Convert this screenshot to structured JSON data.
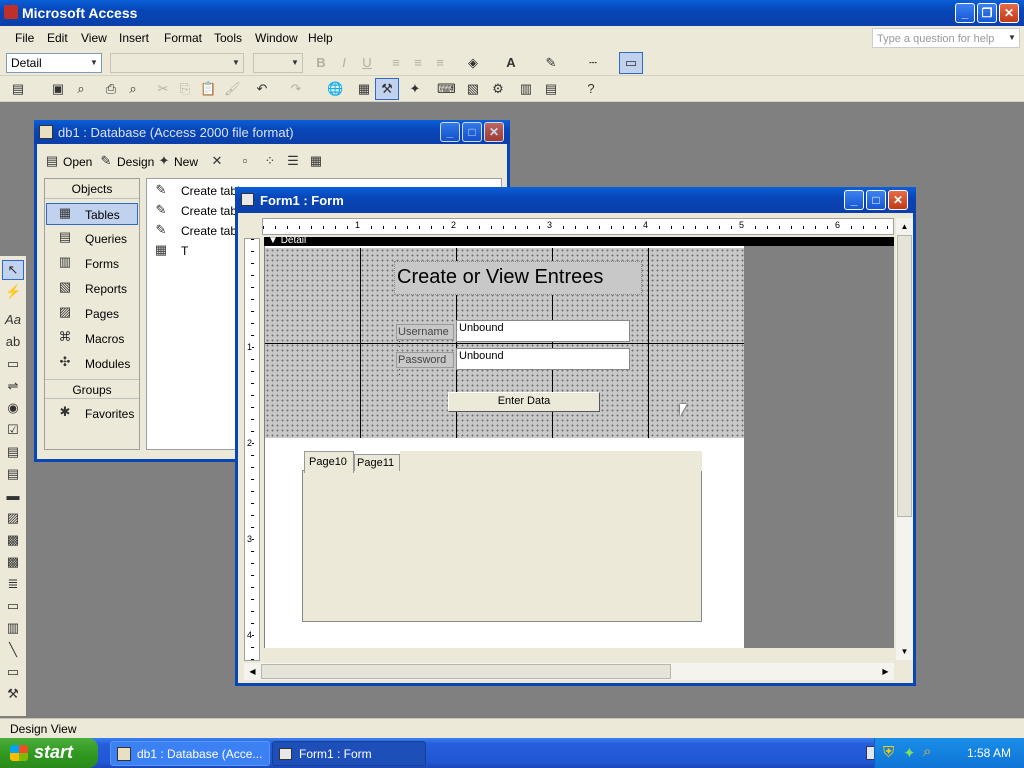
{
  "app": {
    "title": "Microsoft Access"
  },
  "menu": [
    "File",
    "Edit",
    "View",
    "Insert",
    "Format",
    "Tools",
    "Window",
    "Help"
  ],
  "help_box": {
    "placeholder": "Type a question for help"
  },
  "toolbar": {
    "object_combo": "Detail"
  },
  "db_window": {
    "title": "db1 : Database (Access 2000 file format)",
    "toolbar": {
      "open": "Open",
      "design": "Design",
      "new": "New"
    },
    "objects_header": "Objects",
    "objects": [
      "Tables",
      "Queries",
      "Forms",
      "Reports",
      "Pages",
      "Macros",
      "Modules"
    ],
    "groups_header": "Groups",
    "groups": [
      "Favorites"
    ],
    "items": [
      "Create tabl",
      "Create tabl",
      "Create tabl",
      "T"
    ]
  },
  "form_window": {
    "title": "Form1 : Form",
    "section": "Detail",
    "ruler_marks": [
      "1",
      "2",
      "3",
      "4",
      "5",
      "6"
    ],
    "vruler_marks": [
      "1",
      "2",
      "3",
      "4"
    ],
    "form_title": "Create or View Entrees",
    "username_label": "Username :",
    "username_value": "Unbound",
    "password_label": "Password :",
    "password_value": "Unbound",
    "button_label": "Enter Data",
    "tabs": [
      "Page10",
      "Page11"
    ]
  },
  "status": {
    "text": "Design View"
  },
  "taskbar": {
    "start": "start",
    "tasks": [
      "db1 : Database (Acce...",
      "Form1 : Form"
    ],
    "clock": "1:58 AM"
  }
}
